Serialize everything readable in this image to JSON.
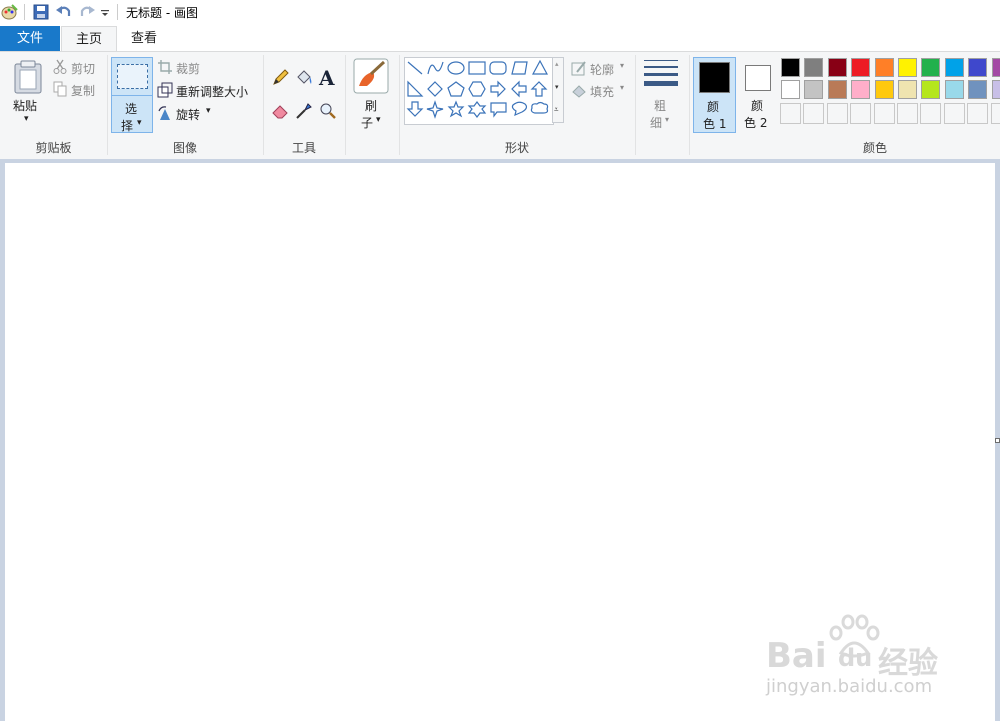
{
  "window": {
    "title": "无标题 - 画图"
  },
  "tabs": {
    "file": "文件",
    "home": "主页",
    "view": "查看"
  },
  "clipboard": {
    "paste": "粘贴",
    "cut": "剪切",
    "copy": "复制",
    "label": "剪贴板"
  },
  "image": {
    "select_1": "选",
    "select_2": "择",
    "crop": "裁剪",
    "resize": "重新调整大小",
    "rotate": "旋转",
    "label": "图像"
  },
  "tools": {
    "label": "工具",
    "text_glyph": "A"
  },
  "brushes": {
    "label_1": "刷",
    "label_2": "子"
  },
  "shapes": {
    "outline": "轮廓",
    "fill": "填充",
    "label": "形状"
  },
  "size": {
    "label_1": "粗",
    "label_2": "细"
  },
  "color1": {
    "label_1": "颜",
    "label_2": "色 1",
    "value": "#000000"
  },
  "color2": {
    "label_1": "颜",
    "label_2": "色 2",
    "value": "#ffffff"
  },
  "colors": {
    "label": "颜色",
    "row1": [
      "#000000",
      "#7f7f7f",
      "#880015",
      "#ed1c24",
      "#ff7f27",
      "#fff200",
      "#22b14c",
      "#00a2e8",
      "#3f48cc",
      "#a349a4"
    ],
    "row2": [
      "#ffffff",
      "#c3c3c3",
      "#b97a57",
      "#ffaec9",
      "#ffc90e",
      "#efe4b0",
      "#b5e61d",
      "#99d9ea",
      "#7092be",
      "#c8bfe7"
    ]
  },
  "watermark": {
    "brand": "Bai",
    "brand2": "du",
    "cn": "经验",
    "url": "jingyan.baidu.com"
  }
}
